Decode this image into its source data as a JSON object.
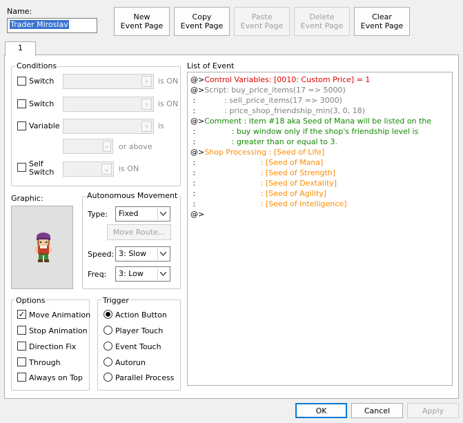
{
  "name_label": "Name:",
  "name_value": "Trader Miroslav",
  "toolbar": [
    {
      "id": "new",
      "line1": "New",
      "line2": "Event Page",
      "enabled": true
    },
    {
      "id": "copy",
      "line1": "Copy",
      "line2": "Event Page",
      "enabled": true
    },
    {
      "id": "paste",
      "line1": "Paste",
      "line2": "Event Page",
      "enabled": false
    },
    {
      "id": "delete",
      "line1": "Delete",
      "line2": "Event Page",
      "enabled": false
    },
    {
      "id": "clear",
      "line1": "Clear",
      "line2": "Event Page",
      "enabled": true
    }
  ],
  "tab_label": "1",
  "conditions": {
    "title": "Conditions",
    "switch1": {
      "label": "Switch",
      "suffix": "is ON"
    },
    "switch2": {
      "label": "Switch",
      "suffix": "is ON"
    },
    "variable": {
      "label": "Variable",
      "suffix": "is",
      "above": "or above"
    },
    "self_switch": {
      "label1": "Self",
      "label2": "Switch",
      "suffix": "is ON"
    },
    "arrow_glyph": "›",
    "spin_glyph": "⌄"
  },
  "graphic_label": "Graphic:",
  "autonomous": {
    "title": "Autonomous Movement",
    "type_label": "Type:",
    "type_value": "Fixed",
    "move_route": "Move Route...",
    "speed_label": "Speed:",
    "speed_value": "3: Slow",
    "freq_label": "Freq:",
    "freq_value": "3: Low"
  },
  "options": {
    "title": "Options",
    "items": [
      {
        "label": "Move Animation",
        "checked": true
      },
      {
        "label": "Stop Animation",
        "checked": false
      },
      {
        "label": "Direction Fix",
        "checked": false
      },
      {
        "label": "Through",
        "checked": false
      },
      {
        "label": "Always on Top",
        "checked": false
      }
    ]
  },
  "trigger": {
    "title": "Trigger",
    "items": [
      {
        "label": "Action Button",
        "selected": true
      },
      {
        "label": "Player Touch",
        "selected": false
      },
      {
        "label": "Event Touch",
        "selected": false
      },
      {
        "label": "Autorun",
        "selected": false
      },
      {
        "label": "Parallel Process",
        "selected": false
      }
    ]
  },
  "event_list": {
    "title": "List of Event",
    "lines": [
      [
        {
          "t": "@>",
          "c": "black"
        },
        {
          "t": "Control Variables: [0010: Custom Price] = 1",
          "c": "red"
        }
      ],
      [
        {
          "t": "@>",
          "c": "black"
        },
        {
          "t": "Script: buy_price_items(17 => 5000)",
          "c": "gray"
        }
      ],
      [
        {
          "t": " :",
          "c": "black"
        },
        {
          "t": "            : sell_price_items(17 => 3000)",
          "c": "gray"
        }
      ],
      [
        {
          "t": " :",
          "c": "black"
        },
        {
          "t": "            : price_shop_friendship_min(3, 0, 18)",
          "c": "gray"
        }
      ],
      [
        {
          "t": "@>",
          "c": "black"
        },
        {
          "t": "Comment : item #18 aka Seed of Mana will be listed on the",
          "c": "green"
        }
      ],
      [
        {
          "t": " :",
          "c": "black"
        },
        {
          "t": "               : buy window only if the shop's friendship level is",
          "c": "green"
        }
      ],
      [
        {
          "t": " :",
          "c": "black"
        },
        {
          "t": "               : greater than or equal to 3.",
          "c": "green"
        }
      ],
      [
        {
          "t": "@>",
          "c": "black"
        },
        {
          "t": "Shop Processing : [Seed of Life]",
          "c": "orange"
        }
      ],
      [
        {
          "t": " :",
          "c": "black"
        },
        {
          "t": "                           : [Seed of Mana]",
          "c": "orange"
        }
      ],
      [
        {
          "t": " :",
          "c": "black"
        },
        {
          "t": "                           : [Seed of Strength]",
          "c": "orange"
        }
      ],
      [
        {
          "t": " :",
          "c": "black"
        },
        {
          "t": "                           : [Seed of Dextality]",
          "c": "orange"
        }
      ],
      [
        {
          "t": " :",
          "c": "black"
        },
        {
          "t": "                           : [Seed of Agility]",
          "c": "orange"
        }
      ],
      [
        {
          "t": " :",
          "c": "black"
        },
        {
          "t": "                           : [Seed of Intelligence]",
          "c": "orange"
        }
      ],
      [
        {
          "t": "@>",
          "c": "black"
        }
      ]
    ]
  },
  "footer": {
    "ok": "OK",
    "cancel": "Cancel",
    "apply": "Apply"
  },
  "icons": {
    "check": "✓"
  }
}
